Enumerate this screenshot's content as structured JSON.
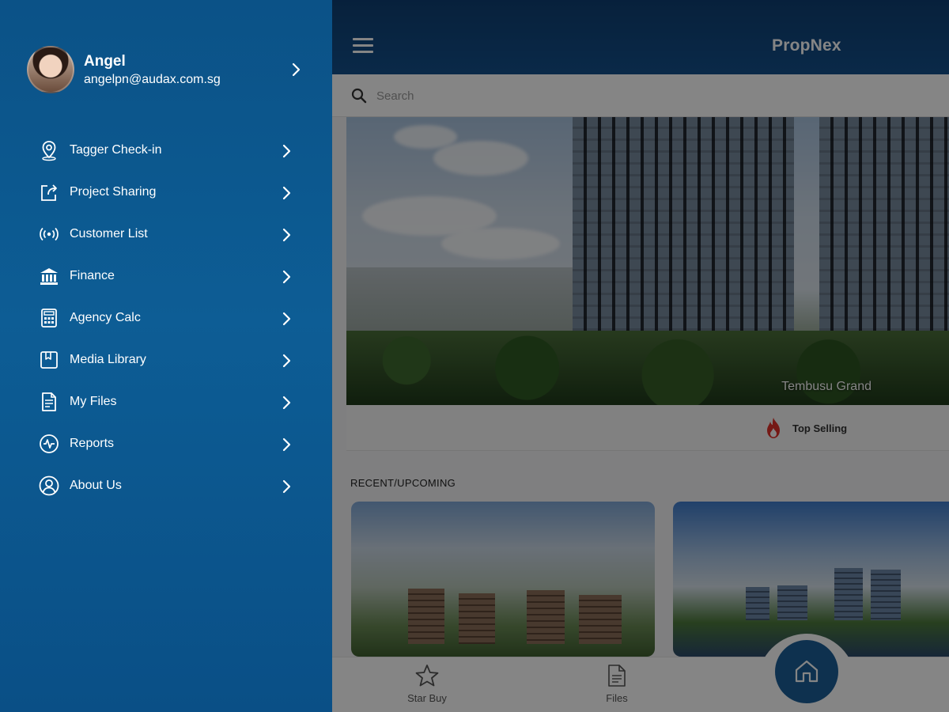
{
  "header": {
    "brand": "PropNex"
  },
  "search": {
    "placeholder": "Search"
  },
  "hero": {
    "caption": "Tembusu Grand"
  },
  "badge": {
    "label": "Top Selling"
  },
  "section": {
    "title": "RECENT/UPCOMING"
  },
  "bottom_nav": {
    "items": [
      {
        "label": "Star Buy",
        "icon": "star-icon"
      },
      {
        "label": "Files",
        "icon": "file-icon"
      },
      {
        "label": "",
        "icon": "home-icon"
      }
    ]
  },
  "drawer": {
    "profile": {
      "name": "Angel",
      "email": "angelpn@audax.com.sg"
    },
    "items": [
      {
        "label": "Tagger Check-in",
        "icon": "location-pin-icon"
      },
      {
        "label": "Project Sharing",
        "icon": "share-icon"
      },
      {
        "label": "Customer List",
        "icon": "broadcast-icon"
      },
      {
        "label": "Finance",
        "icon": "bank-icon"
      },
      {
        "label": "Agency Calc",
        "icon": "calculator-icon"
      },
      {
        "label": "Media Library",
        "icon": "media-icon"
      },
      {
        "label": "My Files",
        "icon": "document-icon"
      },
      {
        "label": "Reports",
        "icon": "reports-icon"
      },
      {
        "label": "About Us",
        "icon": "user-circle-icon"
      }
    ]
  },
  "colors": {
    "drawer": "#0b5287",
    "topbar": "#0f3f73",
    "accent_home": "#1c5f98",
    "fire": "#e0312a"
  }
}
